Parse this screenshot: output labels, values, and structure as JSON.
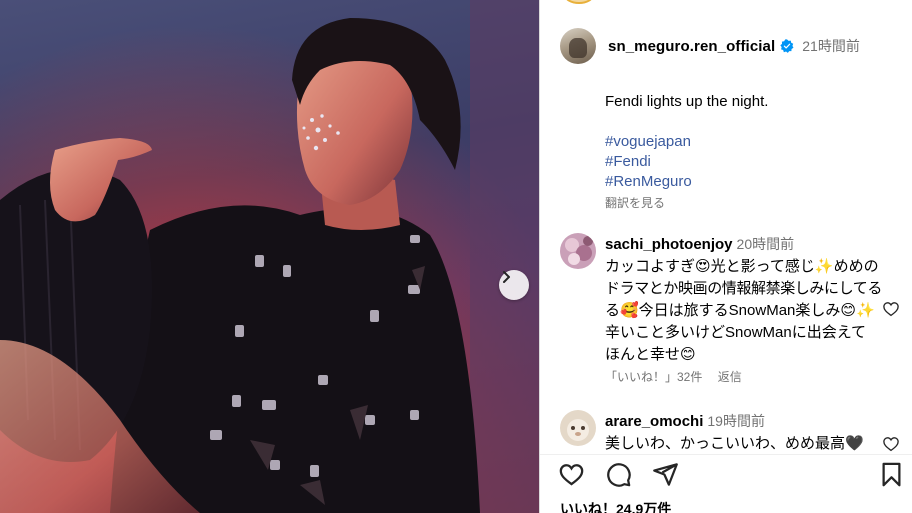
{
  "post": {
    "username": "sn_meguro.ren_official",
    "time": "21時間前",
    "caption": "Fendi lights up the night.",
    "hashtags": [
      "#voguejapan",
      "#Fendi",
      "#RenMeguro"
    ],
    "translate_label": "翻訳を見る",
    "likes": "いいね！24.9万件"
  },
  "comments": [
    {
      "username": "sachi_photoenjoy",
      "time": "20時間前",
      "lines": [
        "カッコよすぎ😍光と影って感じ✨めめの",
        "ドラマとか映画の情報解禁楽しみにしてる",
        "る🥰今日は旅するSnowMan楽しみ😊✨",
        "辛いこと多いけどSnowManに出会えて",
        "ほんと幸せ😊"
      ],
      "likes_label": "「いいね！」32件",
      "reply_label": "返信"
    },
    {
      "username": "arare_omochi",
      "time": "19時間前",
      "lines": [
        "美しいわ、かっこいいわ、めめ最高🖤"
      ]
    }
  ],
  "icons": {
    "verified": "verified-badge-icon",
    "next": "chevron-right-icon",
    "like": "heart-icon",
    "comment": "comment-icon",
    "share": "paper-plane-icon",
    "save": "bookmark-icon"
  },
  "colors": {
    "verified": "#0095f6",
    "hashtag": "#3a5a9e",
    "secondary_text": "#737373"
  }
}
